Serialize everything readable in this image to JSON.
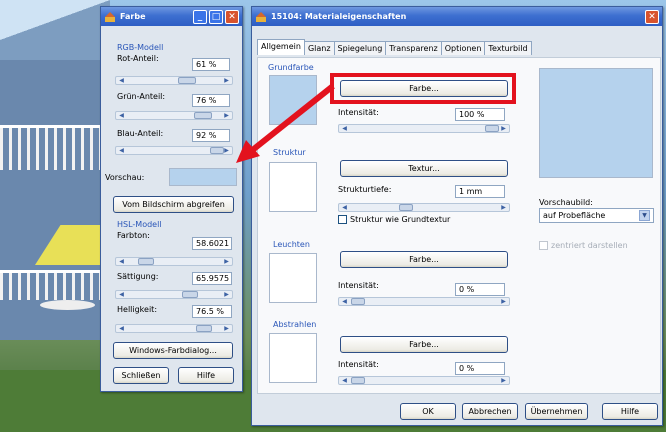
{
  "farbe": {
    "title": "Farbe",
    "rgb_group": "RGB-Modell",
    "rot_label": "Rot-Anteil:",
    "rot_value": "61 %",
    "gruen_label": "Grün-Anteil:",
    "gruen_value": "76 %",
    "blau_label": "Blau-Anteil:",
    "blau_value": "92 %",
    "vorschau_label": "Vorschau:",
    "vorschau_color": "#b5d2ed",
    "screen_button": "Vom Bildschirm abgreifen",
    "hsl_group": "HSL-Modell",
    "farbton_label": "Farbton:",
    "farbton_value": "58.6021",
    "saettigung_label": "Sättigung:",
    "saettigung_value": "65.9575",
    "helligkeit_label": "Helligkeit:",
    "helligkeit_value": "76.5 %",
    "windows_button": "Windows-Farbdialog...",
    "close_button": "Schließen",
    "help_button": "Hilfe"
  },
  "material": {
    "title": "15104: Materialeigenschaften",
    "tabs": [
      "Allgemein",
      "Glanz",
      "Spiegelung",
      "Transparenz",
      "Optionen",
      "Texturbild"
    ],
    "grundfarbe_group": "Grundfarbe",
    "grundfarbe_color": "#b5d2ed",
    "farbe_button": "Farbe...",
    "intensitaet_label": "Intensität:",
    "grund_intensity": "100 %",
    "struktur_group": "Struktur",
    "textur_button": "Textur...",
    "strukturtiefe_label": "Strukturtiefe:",
    "strukturtiefe_value": "1 mm",
    "struktur_check": "Struktur wie Grundtextur",
    "leuchten_group": "Leuchten",
    "leuchten_farbe_button": "Farbe...",
    "leuchten_intensity": "0 %",
    "abstrahlen_group": "Abstrahlen",
    "abstrahlen_farbe_button": "Farbe...",
    "abstrahlen_intensity": "0 %",
    "vorschaubild_label": "Vorschaubild:",
    "vorschaubild_select": "auf Probefläche",
    "zentriert_check": "zentriert darstellen",
    "ok_button": "OK",
    "abbrechen_button": "Abbrechen",
    "uebernehmen_button": "Übernehmen",
    "hilfe_button": "Hilfe"
  },
  "colors": {
    "highlight": "#e3121e",
    "arrow": "#e3121e"
  }
}
